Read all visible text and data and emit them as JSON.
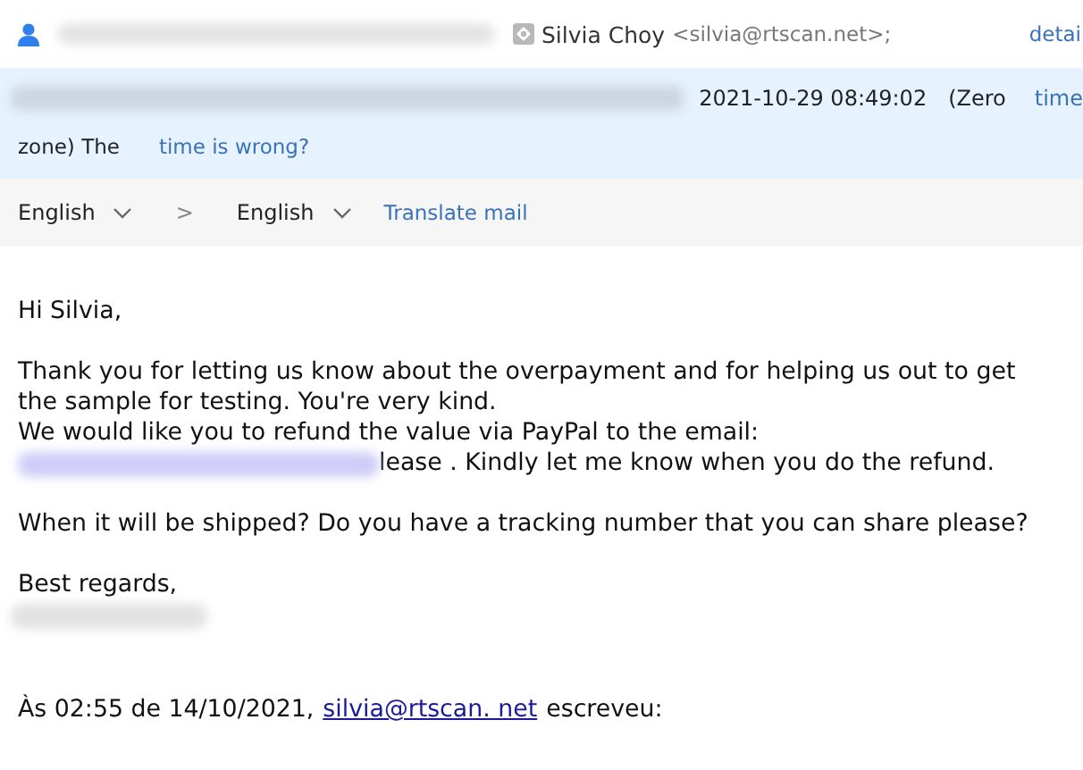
{
  "header": {
    "sender_name": "Silvia Choy",
    "sender_address": "<silvia@rtscan.net>;",
    "details_link": "detai"
  },
  "time_notice": {
    "datetime": "2021-10-29 08:49:02",
    "zone_start": "(Zero",
    "time_link": "time",
    "zone_end": "zone) The",
    "wrong_link": "time is wrong?"
  },
  "translate_bar": {
    "source_language": "English",
    "arrow": ">",
    "target_language": "English",
    "action": "Translate mail"
  },
  "body": [
    {
      "kind": "text",
      "text": "Hi Silvia,"
    },
    {
      "kind": "blank"
    },
    {
      "kind": "text",
      "text": "Thank you for letting us know about the overpayment and for helping us out to get the sample for testing. You're very kind."
    },
    {
      "kind": "text",
      "text": "We would like you to refund the value via PayPal to the email:"
    },
    {
      "kind": "redacted_text",
      "text": "lease . Kindly let me know when you do the refund."
    },
    {
      "kind": "blank"
    },
    {
      "kind": "text",
      "text": "When it will be shipped? Do you have a tracking number that you can share please?"
    },
    {
      "kind": "blank"
    },
    {
      "kind": "text",
      "text": "Best regards,"
    },
    {
      "kind": "redacted"
    },
    {
      "kind": "blank"
    },
    {
      "kind": "blank"
    },
    {
      "kind": "quote",
      "before": "Às 02:55 de 14/10/2021,",
      "link": "silvia@rtscan. net",
      "after": "escreveu:"
    }
  ]
}
